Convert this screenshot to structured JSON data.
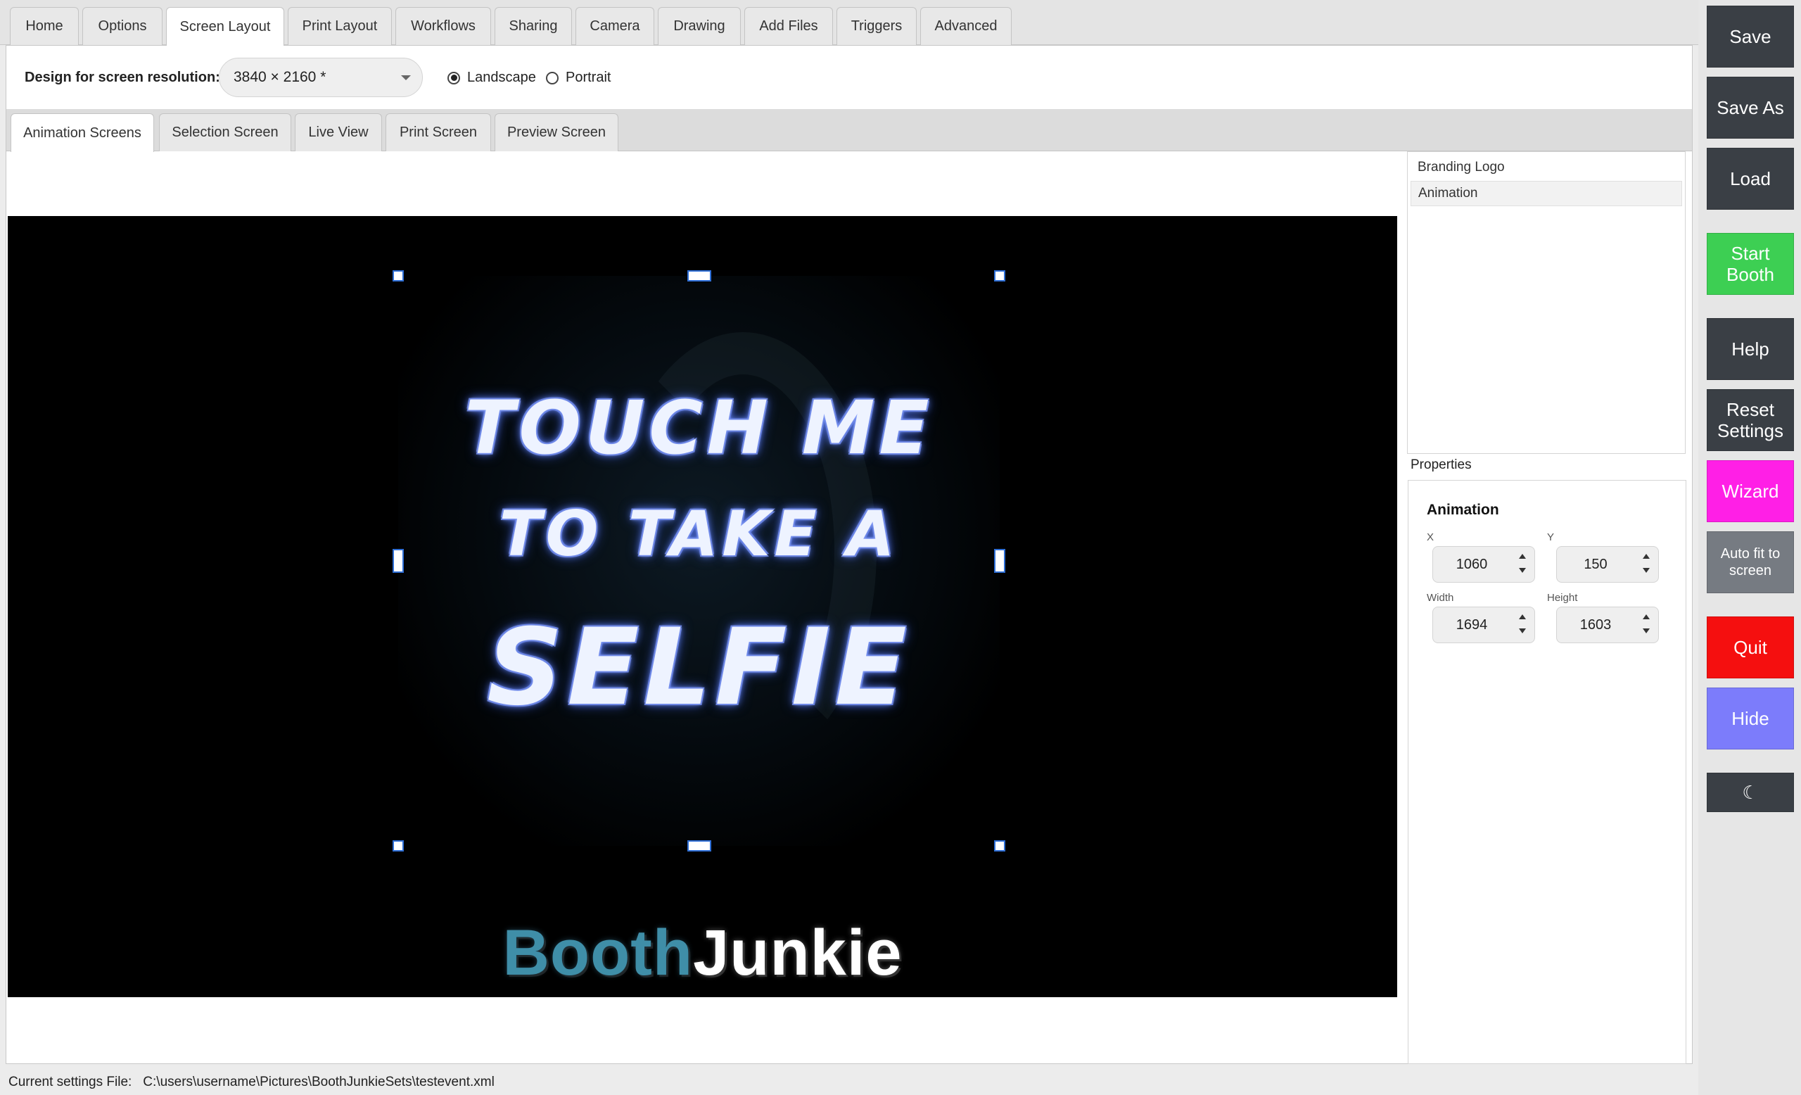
{
  "top_tabs": [
    {
      "label": "Home"
    },
    {
      "label": "Options"
    },
    {
      "label": "Screen Layout"
    },
    {
      "label": "Print Layout"
    },
    {
      "label": "Workflows"
    },
    {
      "label": "Sharing"
    },
    {
      "label": "Camera"
    },
    {
      "label": "Drawing"
    },
    {
      "label": "Add Files"
    },
    {
      "label": "Triggers"
    },
    {
      "label": "Advanced"
    }
  ],
  "active_top_tab": "Screen Layout",
  "resolution": {
    "label": "Design for screen resolution:",
    "value": "3840 × 2160 *",
    "orientation_options": [
      "Landscape",
      "Portrait"
    ],
    "selected_orientation": "Landscape"
  },
  "sub_tabs": [
    {
      "label": "Animation Screens"
    },
    {
      "label": "Selection Screen"
    },
    {
      "label": "Live View"
    },
    {
      "label": "Print Screen"
    },
    {
      "label": "Preview Screen"
    }
  ],
  "active_sub_tab": "Animation Screens",
  "canvas": {
    "animation_text": [
      "Touch me",
      "to take a",
      "Selfie"
    ],
    "branding": {
      "part1": "Booth",
      "part2": "Junkie"
    }
  },
  "layers": [
    {
      "label": "Branding Logo"
    },
    {
      "label": "Animation"
    }
  ],
  "selected_layer": "Animation",
  "properties": {
    "title": "Properties",
    "heading": "Animation",
    "x_label": "X",
    "x_value": "1060",
    "y_label": "Y",
    "y_value": "150",
    "width_label": "Width",
    "width_value": "1694",
    "height_label": "Height",
    "height_value": "1603"
  },
  "status": {
    "label": "Current settings File:",
    "path": "C:\\users\\username\\Pictures\\BoothJunkieSets\\testevent.xml"
  },
  "sidebar": {
    "save": "Save",
    "save_as": "Save As",
    "load": "Load",
    "start_booth": "Start Booth",
    "help": "Help",
    "reset_settings": "Reset Settings",
    "wizard": "Wizard",
    "auto_fit": "Auto fit to screen",
    "quit": "Quit",
    "hide": "Hide",
    "theme_toggle": "☾"
  },
  "colors": {
    "start_booth": "#3dcf53",
    "wizard": "#ff1fe6",
    "quit": "#f50f0f",
    "hide": "#7c7cfb",
    "dark_button": "#3a3f45",
    "brand_booth": "#3f8ea8",
    "handle_border": "#2f6fd6"
  }
}
